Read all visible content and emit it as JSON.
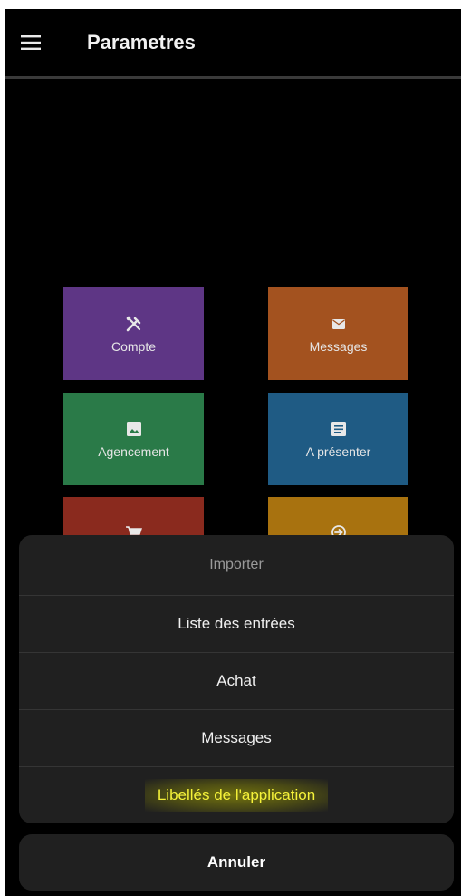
{
  "appbar": {
    "title": "Parametres",
    "menu_icon": "hamburger-menu-icon"
  },
  "colors": {
    "compte": "#5e3685",
    "messages": "#a3521f",
    "agencement": "#2a7a48",
    "presenter": "#1f5b84",
    "achat": "#8a2a1e",
    "importer": "#a8720f"
  },
  "tiles": [
    {
      "label": "Compte",
      "icon": "tools-icon"
    },
    {
      "label": "Messages",
      "icon": "envelope-icon"
    },
    {
      "label": "Agencement",
      "icon": "image-icon"
    },
    {
      "label": "A présenter",
      "icon": "document-icon"
    },
    {
      "label": "",
      "icon": "cart-icon"
    },
    {
      "label": "",
      "icon": "import-icon"
    }
  ],
  "sheet": {
    "header": "Importer",
    "items": [
      "Liste des entrées",
      "Achat",
      "Messages",
      "Libellés de l'application"
    ],
    "cancel": "Annuler"
  }
}
